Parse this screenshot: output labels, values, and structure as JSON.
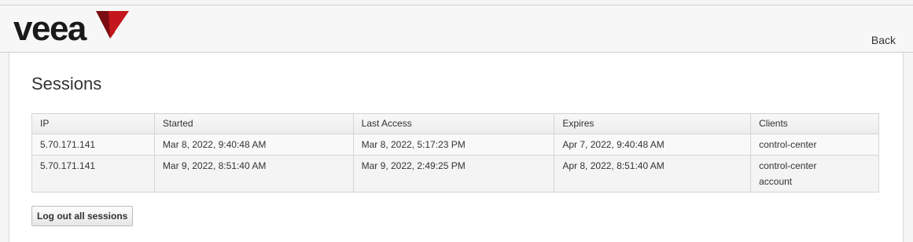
{
  "brand": {
    "name": "veea",
    "accent": "#c4161c",
    "accent_dark": "#7a0d12"
  },
  "header": {
    "back_label": "Back"
  },
  "page": {
    "title": "Sessions"
  },
  "sessions_table": {
    "columns": [
      "IP",
      "Started",
      "Last Access",
      "Expires",
      "Clients"
    ],
    "rows": [
      {
        "ip": "5.70.171.141",
        "started": "Mar 8, 2022, 9:40:48 AM",
        "last_access": "Mar 8, 2022, 5:17:23 PM",
        "expires": "Apr 7, 2022, 9:40:48 AM",
        "clients": [
          "control-center"
        ]
      },
      {
        "ip": "5.70.171.141",
        "started": "Mar 9, 2022, 8:51:40 AM",
        "last_access": "Mar 9, 2022, 2:49:25 PM",
        "expires": "Apr 8, 2022, 8:51:40 AM",
        "clients": [
          "control-center",
          "account"
        ]
      }
    ]
  },
  "actions": {
    "logout_all_label": "Log out all sessions"
  }
}
